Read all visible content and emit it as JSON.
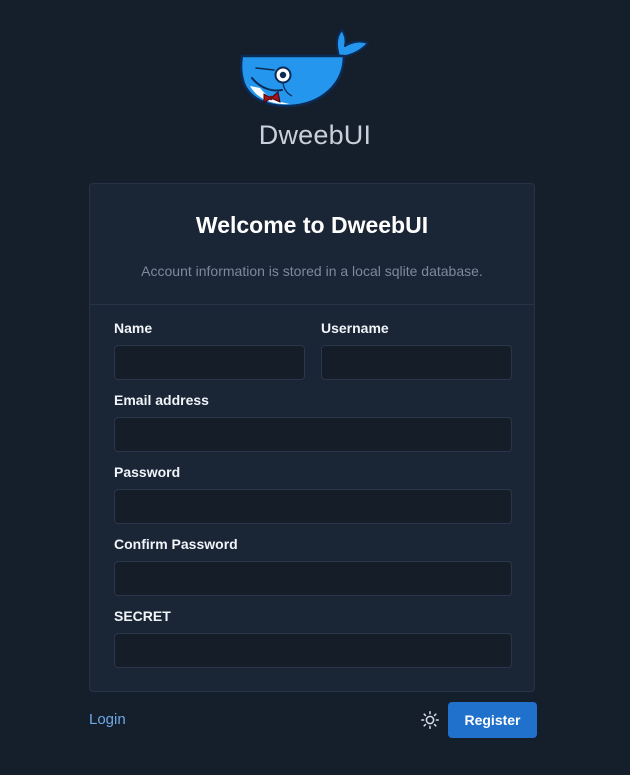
{
  "brand": {
    "name": "DweebUI",
    "logo_icon": "whale-logo-icon"
  },
  "card": {
    "title": "Welcome to DweebUI",
    "subtitle": "Account information is stored in a local sqlite database."
  },
  "form": {
    "name_label": "Name",
    "name_value": "",
    "username_label": "Username",
    "username_value": "",
    "email_label": "Email address",
    "email_value": "",
    "password_label": "Password",
    "password_value": "",
    "confirm_label": "Confirm Password",
    "confirm_value": "",
    "secret_label": "SECRET",
    "secret_value": ""
  },
  "footer": {
    "login_label": "Login",
    "theme_icon": "sun-icon",
    "register_label": "Register"
  },
  "colors": {
    "background": "#151f2c",
    "card": "#1a2535",
    "accent": "#2071cc",
    "link": "#6ea8e6"
  }
}
